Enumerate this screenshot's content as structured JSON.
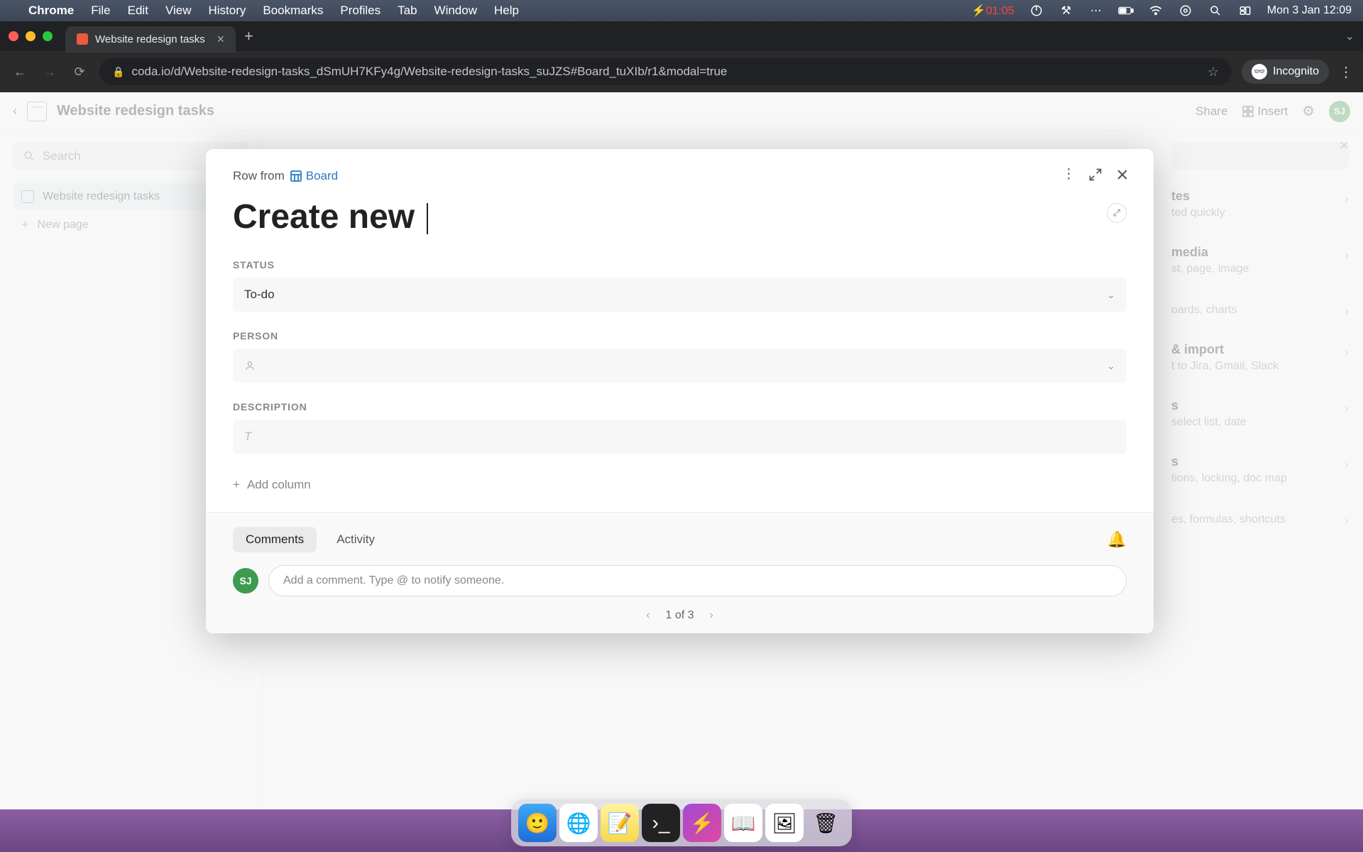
{
  "menubar": {
    "app_name": "Chrome",
    "items": [
      "File",
      "Edit",
      "View",
      "History",
      "Bookmarks",
      "Profiles",
      "Tab",
      "Window",
      "Help"
    ],
    "battery_time": "01:05",
    "date_time": "Mon 3 Jan  12:09"
  },
  "chrome": {
    "tab_title": "Website redesign tasks",
    "url": "coda.io/d/Website-redesign-tasks_dSmUH7KFy4g/Website-redesign-tasks_suJZS#Board_tuXIb/r1&modal=true",
    "incognito_label": "Incognito"
  },
  "app": {
    "doc_title": "Website redesign tasks",
    "topbar": {
      "share": "Share",
      "insert": "Insert"
    },
    "avatar": "SJ",
    "sidebar": {
      "search_placeholder": "Search",
      "page_name": "Website redesign tasks",
      "new_page": "New page"
    }
  },
  "right_panel": {
    "items": [
      {
        "title": "tes",
        "sub": "ted quickly"
      },
      {
        "title": "media",
        "sub": "st, page, image"
      },
      {
        "title": "",
        "sub": "oards, charts"
      },
      {
        "title": "& import",
        "sub": "t to Jira, Gmail, Slack"
      },
      {
        "title": "s",
        "sub": "select list, date"
      },
      {
        "title": "s",
        "sub": "tions, locking, doc map"
      },
      {
        "title": "",
        "sub": "es, formulas, shortcuts"
      }
    ]
  },
  "modal": {
    "row_from_label": "Row from",
    "board_link": "Board",
    "title": "Create new ",
    "fields": {
      "status": {
        "label": "STATUS",
        "value": "To-do"
      },
      "person": {
        "label": "PERSON",
        "value": ""
      },
      "description": {
        "label": "DESCRIPTION",
        "placeholder": "T"
      }
    },
    "add_column": "Add column",
    "tabs": {
      "comments": "Comments",
      "activity": "Activity"
    },
    "comment_placeholder": "Add a comment. Type @ to notify someone.",
    "avatar": "SJ",
    "pagination": "1 of 3"
  },
  "dock": {
    "items": [
      "finder",
      "chrome",
      "notes",
      "terminal",
      "thunder",
      "reader",
      "screentool",
      "trash"
    ]
  }
}
